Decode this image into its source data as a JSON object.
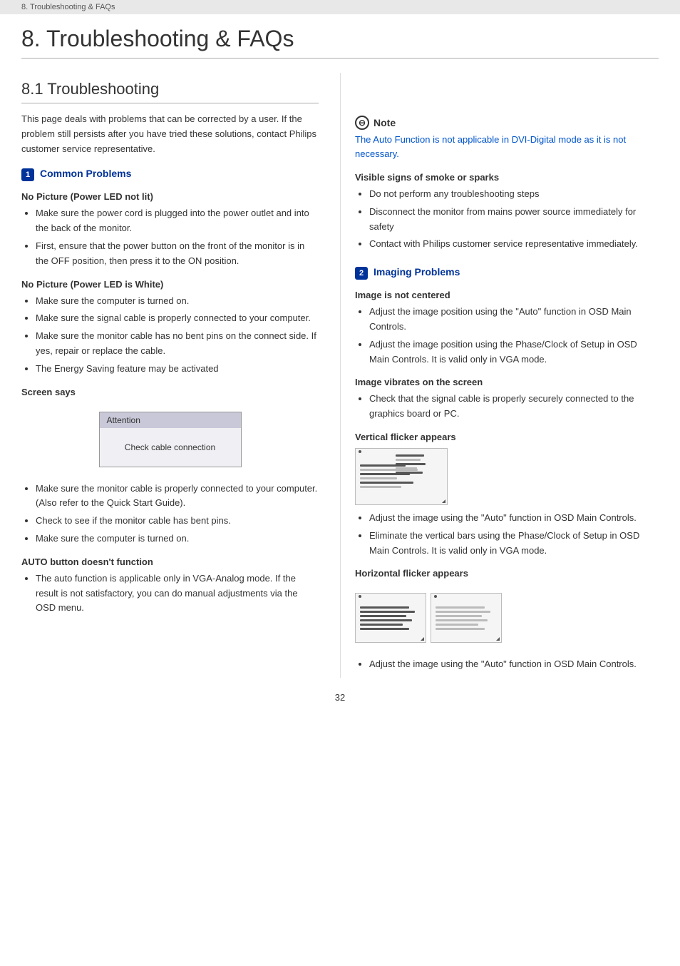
{
  "breadcrumb": "8. Troubleshooting & FAQs",
  "main_title": "8.  Troubleshooting & FAQs",
  "section_8_1_title": "8.1  Troubleshooting",
  "intro": "This page deals with problems that can be corrected by a user. If the problem still persists after you have tried these solutions, contact Philips customer service representative.",
  "common_problems": {
    "badge": "1",
    "heading": "Common Problems",
    "subsections": [
      {
        "title": "No Picture (Power LED not lit)",
        "bullets": [
          "Make sure the power cord is plugged into the power outlet and into the back of the monitor.",
          "First, ensure that the power button on the front of the monitor is in the OFF position, then press it to the ON position."
        ]
      },
      {
        "title": "No Picture (Power LED is White)",
        "bullets": [
          "Make sure the computer is turned on.",
          "Make sure the signal cable is properly connected to your computer.",
          "Make sure the monitor cable has no bent pins on the connect side. If yes, repair or replace the cable.",
          "The Energy Saving feature may be activated"
        ]
      },
      {
        "title": "Screen says",
        "attention_label": "Attention",
        "check_cable_label": "Check cable connection",
        "bullets_after": [
          "Make sure the monitor cable is properly connected to your computer. (Also refer to the Quick Start Guide).",
          "Check to see if the monitor cable has bent pins.",
          "Make sure the computer is turned on."
        ]
      },
      {
        "title": "AUTO button doesn't function",
        "bullets": [
          "The auto function is applicable only in VGA-Analog mode.  If the result is not satisfactory, you can do manual adjustments via the OSD menu."
        ]
      }
    ]
  },
  "note": {
    "icon": "⊖",
    "title": "Note",
    "text": "The Auto Function is not applicable in DVI-Digital mode as it is not necessary."
  },
  "right_sections": [
    {
      "title": "Visible signs of smoke or sparks",
      "bullets": [
        "Do not perform any troubleshooting steps",
        "Disconnect the monitor from mains power source immediately for safety",
        "Contact with Philips customer service representative immediately."
      ]
    }
  ],
  "imaging_problems": {
    "badge": "2",
    "heading": "Imaging Problems",
    "subsections": [
      {
        "title": "Image is not centered",
        "bullets": [
          "Adjust the image position using the \"Auto\" function in OSD Main Controls.",
          "Adjust the image position using the Phase/Clock of Setup in OSD Main Controls.  It is valid only in VGA mode."
        ]
      },
      {
        "title": "Image vibrates on the screen",
        "bullets": [
          "Check that the signal cable is properly securely connected to the graphics board or PC."
        ]
      },
      {
        "title": "Vertical flicker appears",
        "bullets": [
          "Adjust the image using the \"Auto\" function in OSD Main Controls.",
          "Eliminate the vertical bars using the Phase/Clock of Setup in OSD Main Controls. It is valid only in VGA mode."
        ]
      },
      {
        "title": "Horizontal flicker appears",
        "bullets": [
          "Adjust the image using the \"Auto\" function in OSD Main Controls."
        ]
      }
    ]
  },
  "page_number": "32"
}
